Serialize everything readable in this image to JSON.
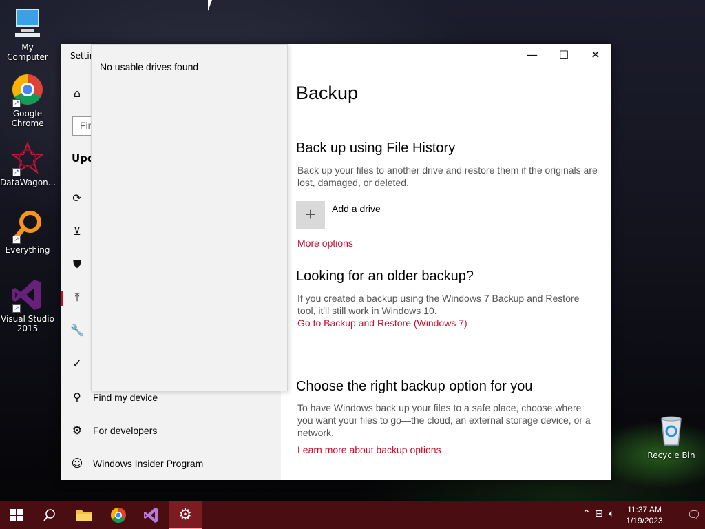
{
  "desktop": {
    "icons": [
      {
        "label": "My Computer",
        "icon": "computer-icon"
      },
      {
        "label": "Google Chrome",
        "icon": "chrome-icon"
      },
      {
        "label": "DataWagon...",
        "icon": "datawagon-icon"
      },
      {
        "label": "Everything",
        "icon": "search-magnifier-icon"
      },
      {
        "label": "Visual Studio 2015",
        "icon": "visual-studio-icon"
      },
      {
        "label": "Recycle Bin",
        "icon": "recycle-bin-icon"
      }
    ]
  },
  "window": {
    "title_partial": "Settin",
    "search_placeholder_partial": "Fir",
    "section_partial": "Upd",
    "nav_items": [
      {
        "label": "Find my device",
        "icon": "find-device-icon"
      },
      {
        "label": "For developers",
        "icon": "developers-icon"
      },
      {
        "label": "Windows Insider Program",
        "icon": "insider-icon"
      }
    ],
    "popup": {
      "message": "No usable drives found"
    },
    "controls": {
      "minimize": "—",
      "maximize": "☐",
      "close": "✕"
    }
  },
  "content": {
    "title": "Backup",
    "file_history": {
      "heading": "Back up using File History",
      "desc": "Back up your files to another drive and restore them if the originals are lost, damaged, or deleted.",
      "add_drive": "Add a drive",
      "more_options": "More options"
    },
    "older_backup": {
      "heading": "Looking for an older backup?",
      "desc": "If you created a backup using the Windows 7 Backup and Restore tool, it'll still work in Windows 10.",
      "link": "Go to Backup and Restore (Windows 7)"
    },
    "right_option": {
      "heading": "Choose the right backup option for you",
      "desc": "To have Windows back up your files to a safe place, choose where you want your files to go—the cloud, an external storage device, or a network.",
      "link": "Learn more about backup options"
    }
  },
  "taskbar": {
    "time": "11:37 AM",
    "date": "1/19/2023"
  },
  "colors": {
    "accent": "#c4122c",
    "taskbar": "#4a0e12"
  }
}
